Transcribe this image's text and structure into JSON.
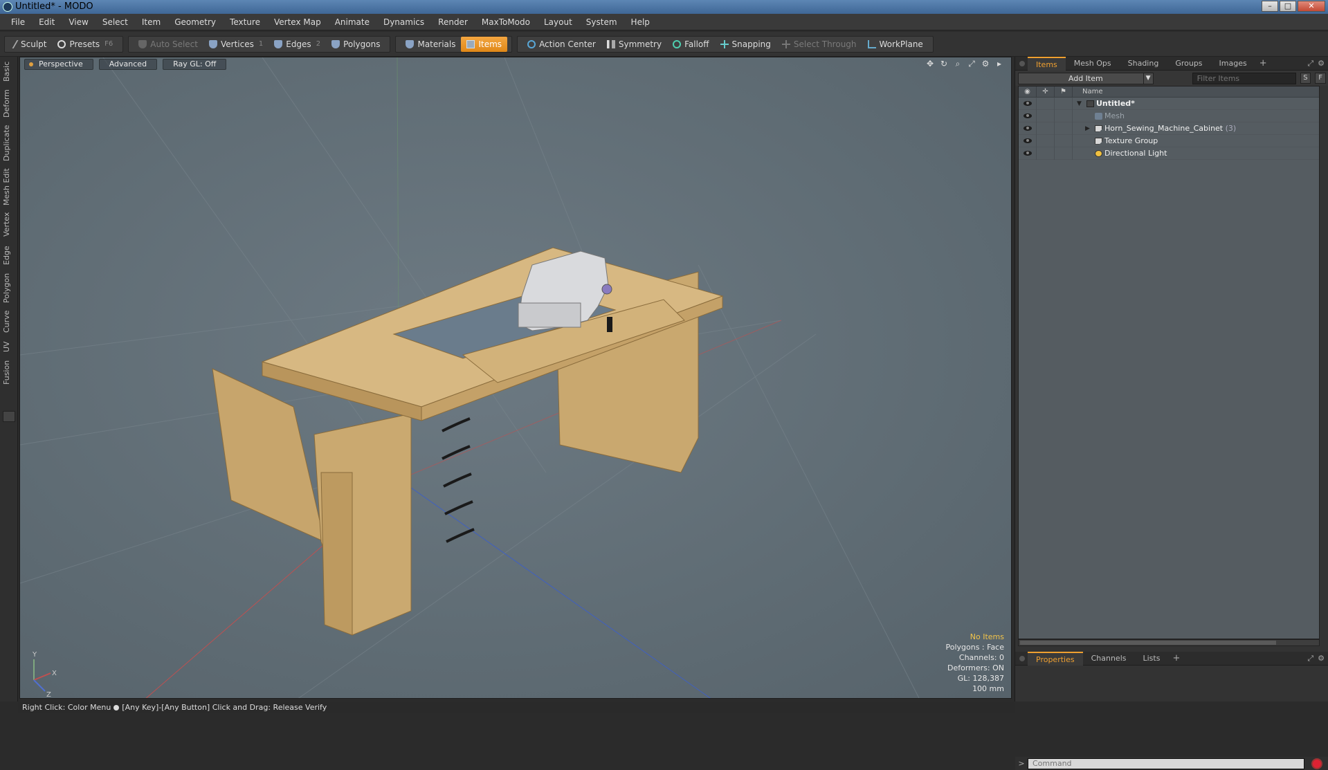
{
  "window": {
    "title": "Untitled* - MODO",
    "controls": [
      "–",
      "□",
      "✕"
    ]
  },
  "menu": [
    "File",
    "Edit",
    "View",
    "Select",
    "Item",
    "Geometry",
    "Texture",
    "Vertex Map",
    "Animate",
    "Dynamics",
    "Render",
    "MaxToModo",
    "Layout",
    "System",
    "Help"
  ],
  "toolbar": {
    "sculpt": "Sculpt",
    "presets": "Presets",
    "presets_key": "F6",
    "auto_select": "Auto Select",
    "vertices": "Vertices",
    "vertices_key": "1",
    "edges": "Edges",
    "edges_key": "2",
    "polygons": "Polygons",
    "materials": "Materials",
    "items": "Items",
    "action_center": "Action Center",
    "symmetry": "Symmetry",
    "falloff": "Falloff",
    "snapping": "Snapping",
    "select_through": "Select Through",
    "workplane": "WorkPlane",
    "accent_color": "#f0a030"
  },
  "left_tabs": [
    "Basic",
    "Deform",
    "Duplicate",
    "Mesh Edit",
    "Vertex",
    "Edge",
    "Polygon",
    "Curve",
    "UV",
    "Fusion"
  ],
  "viewport": {
    "view": "Perspective",
    "mode": "Advanced",
    "raygl": "Ray GL: Off",
    "stats": {
      "selection": "No Items",
      "polygons": "Polygons : Face",
      "channels": "Channels: 0",
      "deformers": "Deformers: ON",
      "gl": "GL: 128,387",
      "scale": "100 mm"
    },
    "axis_labels": {
      "y": "Y",
      "x": "X",
      "z": "Z"
    }
  },
  "items_panel": {
    "tabs": [
      "Items",
      "Mesh Ops",
      "Shading",
      "Groups",
      "Images"
    ],
    "add_item": "Add Item",
    "filter_placeholder": "Filter Items",
    "btn_s": "S",
    "btn_f": "F",
    "column_name": "Name",
    "tree": [
      {
        "label": "Untitled*",
        "icon": "scene-icon"
      },
      {
        "label": "Mesh",
        "icon": "mesh-icon"
      },
      {
        "label": "Horn_Sewing_Machine_Cabinet",
        "count": "(3)",
        "icon": "group-icon"
      },
      {
        "label": "Texture Group",
        "icon": "group-icon"
      },
      {
        "label": "Directional Light",
        "icon": "light-icon"
      }
    ]
  },
  "props_panel": {
    "tabs": [
      "Properties",
      "Channels",
      "Lists"
    ],
    "command_placeholder": "Command"
  },
  "statusbar": {
    "left": "Right Click: Color Menu",
    "right": "[Any Key]-[Any Button] Click and Drag: Release Verify"
  }
}
